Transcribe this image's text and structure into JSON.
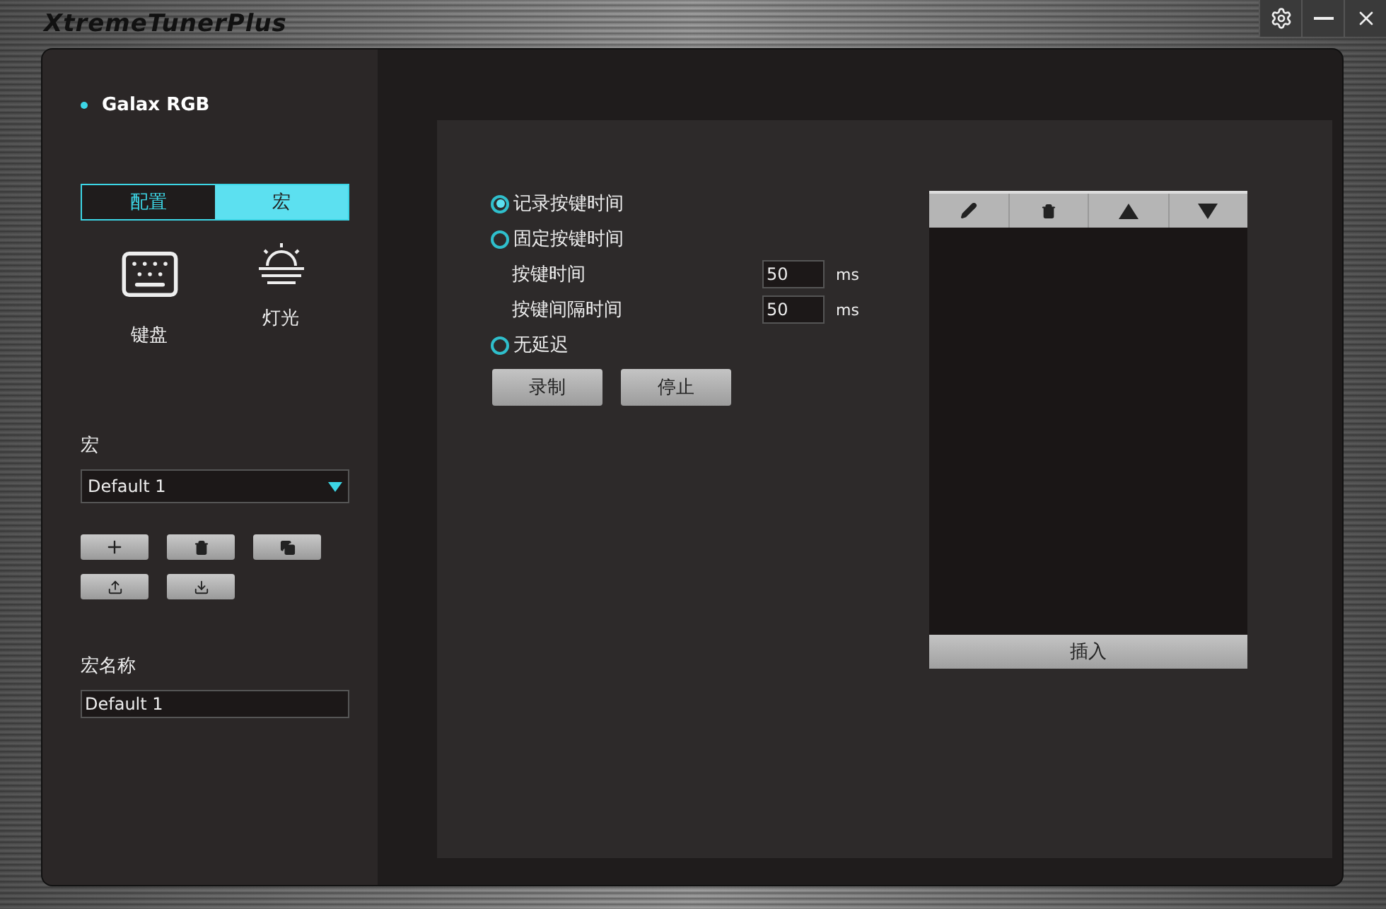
{
  "window": {
    "title": "XtremeTunerPlus",
    "controls": [
      {
        "kind": "settings"
      },
      {
        "kind": "minimize"
      },
      {
        "kind": "close"
      }
    ]
  },
  "device": {
    "name": "Galax RGB"
  },
  "mode_tabs": [
    {
      "label": "配置",
      "selected": false
    },
    {
      "label": "宏",
      "selected": true
    }
  ],
  "categories": [
    {
      "kind": "keyboard",
      "label": "键盘"
    },
    {
      "kind": "light",
      "label": "灯光"
    }
  ],
  "macro_select": {
    "label": "宏",
    "value": "Default 1"
  },
  "macro_actions": [
    {
      "kind": "add"
    },
    {
      "kind": "delete"
    },
    {
      "kind": "copy"
    },
    {
      "kind": "export"
    },
    {
      "kind": "import"
    }
  ],
  "macro_name": {
    "label": "宏名称",
    "value": "Default 1"
  },
  "timing": [
    {
      "kind": "radio",
      "label": "记录按键时间",
      "selected": true
    },
    {
      "kind": "radio",
      "label": "固定按键时间",
      "selected": false
    },
    {
      "kind": "field",
      "label": "按键时间",
      "value": "50",
      "unit": "ms"
    },
    {
      "kind": "field",
      "label": "按键间隔时间",
      "value": "50",
      "unit": "ms"
    },
    {
      "kind": "radio",
      "label": "无延迟",
      "selected": false
    }
  ],
  "record_buttons": [
    "录制",
    "停止"
  ],
  "event_list": {
    "toolbar": [
      {
        "kind": "edit"
      },
      {
        "kind": "delete"
      },
      {
        "kind": "up"
      },
      {
        "kind": "down"
      }
    ],
    "insert_button": "插入"
  }
}
